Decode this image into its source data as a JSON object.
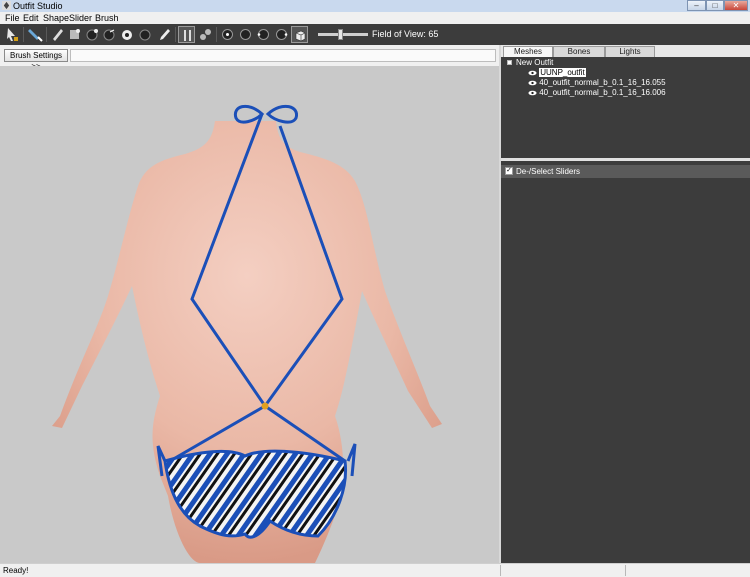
{
  "window": {
    "title": "Outfit Studio"
  },
  "menu": {
    "items": [
      "File",
      "Edit",
      "Shape",
      "Slider",
      "Brush"
    ]
  },
  "toolbar": {
    "fov_label": "Field of View: 65",
    "field_of_view": 65
  },
  "left_panel": {
    "brush_settings_label": "Brush Settings >>"
  },
  "tabs": [
    {
      "label": "Meshes",
      "active": true
    },
    {
      "label": "Bones",
      "active": false
    },
    {
      "label": "Lights",
      "active": false
    }
  ],
  "tree": {
    "root": "New Outfit",
    "children": [
      {
        "label": "UUNP_outfit",
        "selected": true
      },
      {
        "label": "40_outfit_normal_b_0.1_16_16.055",
        "selected": false
      },
      {
        "label": "40_outfit_normal_b_0.1_16_16.006",
        "selected": false
      }
    ]
  },
  "sliders_panel": {
    "label": "De-/Select Sliders",
    "checked": true
  },
  "status": {
    "text": "Ready!"
  },
  "colors": {
    "toolbar": "#3c3c3c",
    "viewport": "#c9c9c9",
    "panel": "#3c3c3c",
    "outfit_blue": "#1b4fb8"
  }
}
